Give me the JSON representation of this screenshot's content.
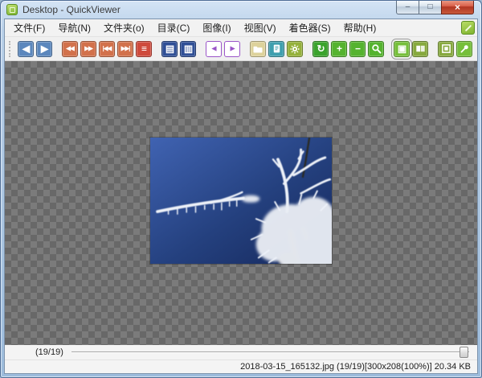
{
  "window": {
    "title": "Desktop - QuickViewer",
    "controls": [
      {
        "id": "minimize",
        "glyph": "–"
      },
      {
        "id": "maximize",
        "glyph": "□"
      },
      {
        "id": "close",
        "glyph": "×"
      }
    ]
  },
  "menu": {
    "items": [
      {
        "id": "file",
        "label": "文件(F)"
      },
      {
        "id": "navigation",
        "label": "导航(N)"
      },
      {
        "id": "folder",
        "label": "文件夹(o)"
      },
      {
        "id": "catalog",
        "label": "目录(C)"
      },
      {
        "id": "image",
        "label": "图像(I)"
      },
      {
        "id": "view",
        "label": "视图(V)"
      },
      {
        "id": "shader",
        "label": "着色器(S)"
      },
      {
        "id": "help",
        "label": "帮助(H)"
      }
    ]
  },
  "toolbar": {
    "icons": [
      {
        "name": "back-icon",
        "glyph": "◀",
        "bg": "#5b87bd"
      },
      {
        "name": "forward-icon",
        "glyph": "▶",
        "bg": "#5b87bd"
      },
      {
        "name": "fast-backward-icon",
        "glyph": "◀◀",
        "bg": "#d2714b",
        "small": true,
        "gap": true
      },
      {
        "name": "fast-forward-icon",
        "glyph": "▶▶",
        "bg": "#d2714b",
        "small": true
      },
      {
        "name": "first-image-icon",
        "glyph": "|◀◀",
        "bg": "#d2714b",
        "small": true
      },
      {
        "name": "last-image-icon",
        "glyph": "▶▶|",
        "bg": "#d2714b",
        "small": true
      },
      {
        "name": "playlist-icon",
        "glyph": "≡",
        "bg": "#cf4a3c"
      },
      {
        "name": "single-page-icon",
        "glyph": "▤",
        "bg": "#2f4f96",
        "gap": true
      },
      {
        "name": "dual-page-icon",
        "glyph": "▥",
        "bg": "#2f4f96"
      },
      {
        "name": "read-left-icon",
        "glyph": "◀",
        "bg": "#ffffff",
        "fg": "#9a55c8",
        "outline": "#9a55c8",
        "small": true,
        "gap": true
      },
      {
        "name": "read-right-icon",
        "glyph": "▶",
        "bg": "#ffffff",
        "fg": "#9a55c8",
        "outline": "#9a55c8",
        "small": true
      },
      {
        "name": "open-folder-icon",
        "shape": "folder",
        "bg": "#ddd29b",
        "gap": true
      },
      {
        "name": "catalog-book-icon",
        "shape": "book",
        "bg": "#3f9fae"
      },
      {
        "name": "settings-gear-icon",
        "shape": "gear",
        "bg": "#95b13b"
      },
      {
        "name": "refresh-icon",
        "glyph": "↻",
        "bg": "#3ba32d",
        "gap": true
      },
      {
        "name": "zoom-in-icon",
        "glyph": "+",
        "bg": "#55b32f"
      },
      {
        "name": "zoom-out-icon",
        "glyph": "−",
        "bg": "#55b32f"
      },
      {
        "name": "magnifier-icon",
        "shape": "magnifier",
        "bg": "#55b32f"
      },
      {
        "name": "fit-window-icon",
        "glyph": "▣",
        "bg": "#76bf3a",
        "selected": true,
        "gap": true
      },
      {
        "name": "spread-view-icon",
        "shape": "spread",
        "bg": "#87a93e"
      },
      {
        "name": "frameless-window-icon",
        "shape": "window",
        "bg": "#87a93e",
        "gap": true
      },
      {
        "name": "stay-on-top-pin-icon",
        "shape": "pin",
        "bg": "#76bf3a"
      }
    ]
  },
  "pager": {
    "label": "(19/19)",
    "value": 19,
    "max": 19
  },
  "statusbar": {
    "text": "2018-03-15_165132.jpg (19/19)[300x208(100%)] 20.34 KB"
  },
  "colors": {
    "titlebar_glass": "#b9d0e9",
    "frame_border": "#4e6d96",
    "toolbar_bg": "#f0f0f0",
    "checker_light": "#7b7b7b",
    "checker_dark": "#686868",
    "selected_icon_green": "#76bf3a",
    "close_button_red": "#b03522",
    "photo_sky_blue": "#24407e"
  }
}
